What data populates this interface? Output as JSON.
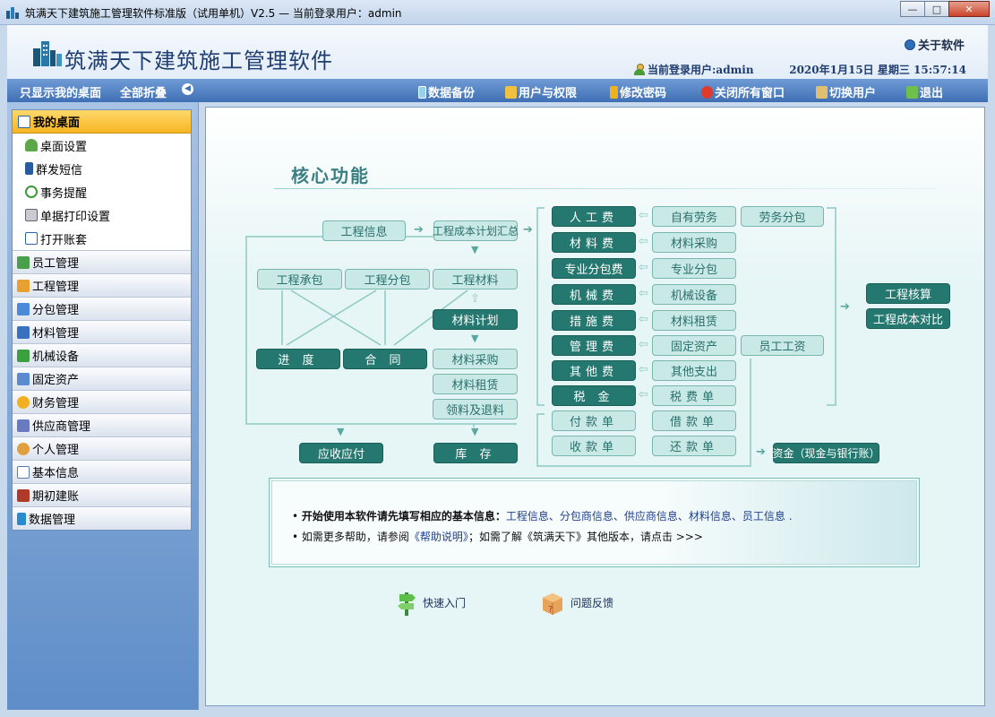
{
  "window": {
    "title": "筑满天下建筑施工管理软件标准版（试用单机）V2.5 — 当前登录用户：admin",
    "min": "—",
    "max": "□",
    "close": "✕"
  },
  "header": {
    "brand": "筑满天下建筑施工管理软件",
    "about": "关于软件",
    "current_user": "当前登录用户:admin",
    "datetime": "2020年1月15日  星期三  15:57:14"
  },
  "toolbar": {
    "only_desk": "只显示我的桌面",
    "collapse_all": "全部折叠",
    "backup": "数据备份",
    "users": "用户与权限",
    "password": "修改密码",
    "close_all": "关闭所有窗口",
    "switch_user": "切换用户",
    "exit": "退出"
  },
  "sidebar": {
    "my_desk": "我的桌面",
    "sub": [
      "桌面设置",
      "群发短信",
      "事务提醒",
      "单据打印设置",
      "打开账套"
    ],
    "groups": [
      "员工管理",
      "工程管理",
      "分包管理",
      "材料管理",
      "机械设备",
      "固定资产",
      "财务管理",
      "供应商管理",
      "个人管理",
      "基本信息",
      "期初建账",
      "数据管理"
    ]
  },
  "main": {
    "core_title": "核心功能",
    "flow": {
      "project_info": "工程信息",
      "cost_plan": "工程成本计划汇总",
      "contract": "工程承包",
      "sub_contract": "工程分包",
      "material": "工程材料",
      "material_plan": "材料计划",
      "progress": "进  度",
      "agreement": "合  同",
      "mat_purchase": "材料采购",
      "mat_rent": "材料租赁",
      "mat_return": "领料及退料",
      "receivable": "应收应付",
      "stock": "库  存",
      "labor": "人工费",
      "materials_fee": "材料费",
      "sub_fee": "专业分包费",
      "machine_fee": "机械费",
      "measure_fee": "措施费",
      "manage_fee": "管理费",
      "other_fee": "其他费",
      "tax": "税  金",
      "own_labor": "自有劳务",
      "labor_sub": "劳务分包",
      "mat_purchase2": "材料采购",
      "pro_sub": "专业分包",
      "mech_equip": "机械设备",
      "mat_rent2": "材料租赁",
      "fixed_asset": "固定资产",
      "salary": "员工工资",
      "other_exp": "其他支出",
      "tax_bill": "税费单",
      "pay_bill": "付款单",
      "borrow_bill": "借款单",
      "receive_bill": "收款单",
      "repay_bill": "还款单",
      "accounting": "工程核算",
      "cost_compare": "工程成本对比",
      "funds": "资金（现金与银行账）"
    },
    "info": {
      "line1_bold": "开始使用本软件请先填写相应的基本信息：",
      "line1_links": "工程信息、分包商信息、供应商信息、材料信息、员工信息 .",
      "line2_a": "如需更多帮助，请参阅",
      "line2_link": "《帮助说明》",
      "line2_b": "；如需了解《筑满天下》其他版本，请点击 >>>"
    },
    "quick_start": "快速入门",
    "feedback": "问题反馈"
  }
}
